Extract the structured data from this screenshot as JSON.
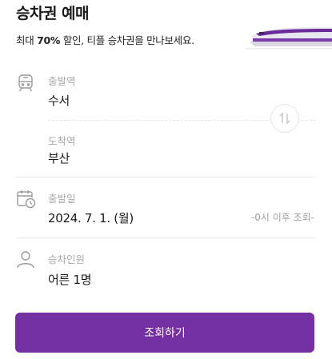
{
  "header": {
    "title": "승차권 예매",
    "subtitle_prefix": "최대 ",
    "subtitle_bold": "70%",
    "subtitle_rest": " 할인, 티플 승차권을 만나보세요."
  },
  "departure": {
    "label": "출발역",
    "value": "수서",
    "icon": "train-icon"
  },
  "arrival": {
    "label": "도착역",
    "value": "부산"
  },
  "date": {
    "label": "출발일",
    "value": "2024. 7. 1. (월)",
    "hint": "-0시 이후 조회-",
    "icon": "calendar-clock-icon"
  },
  "passengers": {
    "label": "승차인원",
    "value": "어른 1명",
    "icon": "person-icon"
  },
  "search_button": {
    "label": "조회하기"
  },
  "colors": {
    "accent": "#7430a3",
    "train_stripe": "#6a2c9a"
  }
}
